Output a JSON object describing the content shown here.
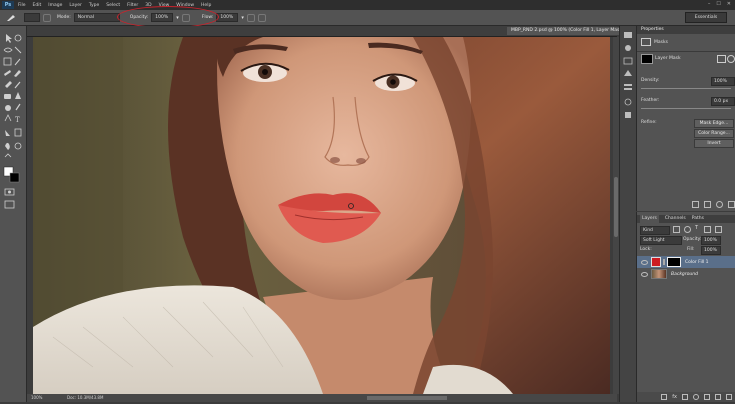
{
  "app": {
    "logo": "Ps"
  },
  "menu": [
    "File",
    "Edit",
    "Image",
    "Layer",
    "Type",
    "Select",
    "Filter",
    "3D",
    "View",
    "Window",
    "Help"
  ],
  "window_controls": [
    "–",
    "☐",
    "✕"
  ],
  "options_bar": {
    "mode_label": "Mode:",
    "mode_value": "Normal",
    "opacity_label": "Opacity:",
    "opacity_value": "100%",
    "flow_label": "Flow:",
    "flow_value": "100%"
  },
  "workspace": "Essentials",
  "document": {
    "tab_title": "MBP_RND 2.psd @ 100% (Color Fill 1, Layer Mask/8) *",
    "status_zoom": "100%",
    "status_doc": "Doc: 10.3M/43.8M"
  },
  "properties": {
    "tab": "Properties",
    "section": "Masks",
    "mask_label": "Layer Mask",
    "density_label": "Density:",
    "density_value": "100%",
    "feather_label": "Feather:",
    "feather_value": "0.0 px",
    "refine_label": "Refine:",
    "buttons": [
      "Mask Edge...",
      "Color Range...",
      "Invert"
    ]
  },
  "layers_panel": {
    "tabs": [
      "Layers",
      "Channels",
      "Paths"
    ],
    "kind_filter": "Kind",
    "blend_mode": "Soft Light",
    "opacity_label": "Opacity:",
    "opacity_value": "100%",
    "lock_label": "Lock:",
    "fill_label": "Fill:",
    "fill_value": "100%",
    "layers": [
      {
        "name": "Color Fill 1",
        "selected": true,
        "thumb_color": "#cc1b22"
      },
      {
        "name": "Background",
        "selected": false,
        "thumb_color": "#8a6a55"
      }
    ]
  },
  "colors": {
    "highlight": "#c8232c",
    "foreground": "#ffffff",
    "background": "#000000"
  }
}
